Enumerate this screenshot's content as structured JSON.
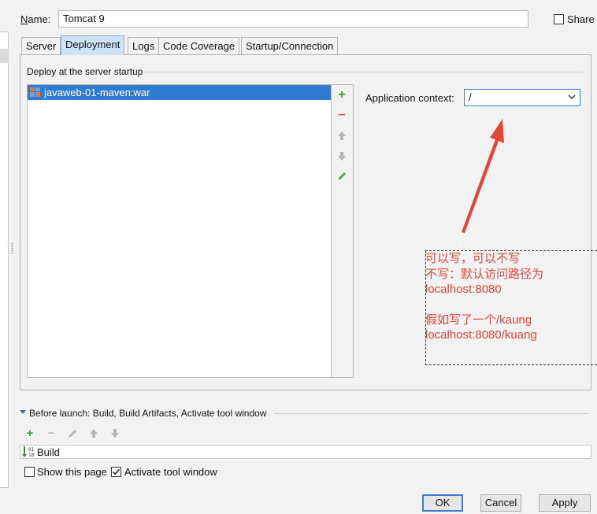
{
  "header": {
    "name_label": "Name:",
    "name_value": "Tomcat 9",
    "share_label": "Share",
    "share_checked": false
  },
  "tabs": [
    {
      "label": "Server",
      "active": false
    },
    {
      "label": "Deployment",
      "active": true
    },
    {
      "label": "Logs",
      "active": false
    },
    {
      "label": "Code Coverage",
      "active": false
    },
    {
      "label": "Startup/Connection",
      "active": false
    }
  ],
  "deployment": {
    "section_label": "Deploy at the server startup",
    "artifacts": [
      "javaweb-01-maven:war"
    ],
    "tools": [
      "add-icon",
      "remove-icon",
      "move-up-icon",
      "move-down-icon",
      "edit-icon"
    ],
    "context_label": "Application context:",
    "context_value": "/"
  },
  "annotation": {
    "lines": [
      "可以写，可以不写",
      "不写：默认访问路径为",
      "localhost:8080",
      "",
      "假如写了一个/kaung",
      "localhost:8080/kuang"
    ],
    "color": "#e24638"
  },
  "before_launch": {
    "label": "Before launch: Build, Build Artifacts, Activate tool window",
    "tools": [
      "add-icon",
      "remove-icon",
      "edit-icon",
      "move-up-icon",
      "move-down-icon"
    ],
    "items": [
      "Build"
    ]
  },
  "options": {
    "show_this_page": {
      "label": "Show this page",
      "checked": false
    },
    "activate_tool_window": {
      "label": "Activate tool window",
      "checked": true
    }
  },
  "buttons": {
    "ok": "OK",
    "cancel": "Cancel",
    "apply": "Apply"
  },
  "colors": {
    "selection": "#2f7bd1",
    "add_green": "#3a9a3a",
    "remove_red": "#d9534f",
    "focus_blue": "#3c7fd1"
  }
}
